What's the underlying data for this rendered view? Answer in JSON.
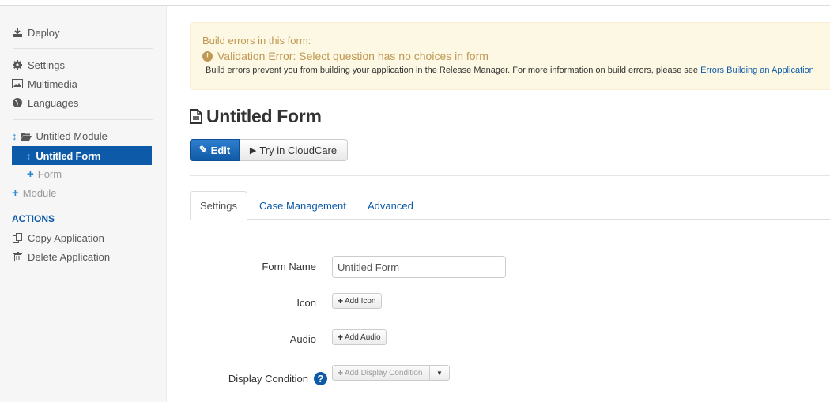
{
  "sidebar": {
    "deploy": {
      "label": "Deploy",
      "icon": "download-icon"
    },
    "settings": {
      "label": "Settings",
      "icon": "gear-icon"
    },
    "multimedia": {
      "label": "Multimedia",
      "icon": "picture-icon"
    },
    "languages": {
      "label": "Languages",
      "icon": "globe-icon"
    },
    "module": {
      "label": "Untitled Module",
      "icon": "folder-open-icon"
    },
    "form_selected": {
      "label": "Untitled Form"
    },
    "add_form": {
      "label": "Form"
    },
    "add_module": {
      "label": "Module"
    },
    "actions_heading": "ACTIONS",
    "copy_app": {
      "label": "Copy Application",
      "icon": "copy-icon"
    },
    "delete_app": {
      "label": "Delete Application",
      "icon": "trash-icon"
    }
  },
  "alert": {
    "heading": "Build errors in this form:",
    "error": "Validation Error: Select question has no choices in form",
    "info": "Build errors prevent you from building your application in the Release Manager. For more information on build errors, please see ",
    "link": "Errors Building an Application"
  },
  "page": {
    "title": "Untitled Form",
    "edit_label": "Edit",
    "try_label": "Try in CloudCare"
  },
  "tabs": [
    {
      "label": "Settings",
      "active": true
    },
    {
      "label": "Case Management",
      "active": false
    },
    {
      "label": "Advanced",
      "active": false
    }
  ],
  "form": {
    "form_name_label": "Form Name",
    "form_name_value": "Untitled Form",
    "icon_label": "Icon",
    "add_icon": "Add Icon",
    "audio_label": "Audio",
    "add_audio": "Add Audio",
    "display_condition_label": "Display Condition",
    "add_display_condition": "Add Display Condition"
  },
  "colors": {
    "accent": "#0c5aa8",
    "alert_bg": "#fcf8e3",
    "alert_text": "#c09853",
    "sidebar_bg": "#f6f6f6"
  }
}
